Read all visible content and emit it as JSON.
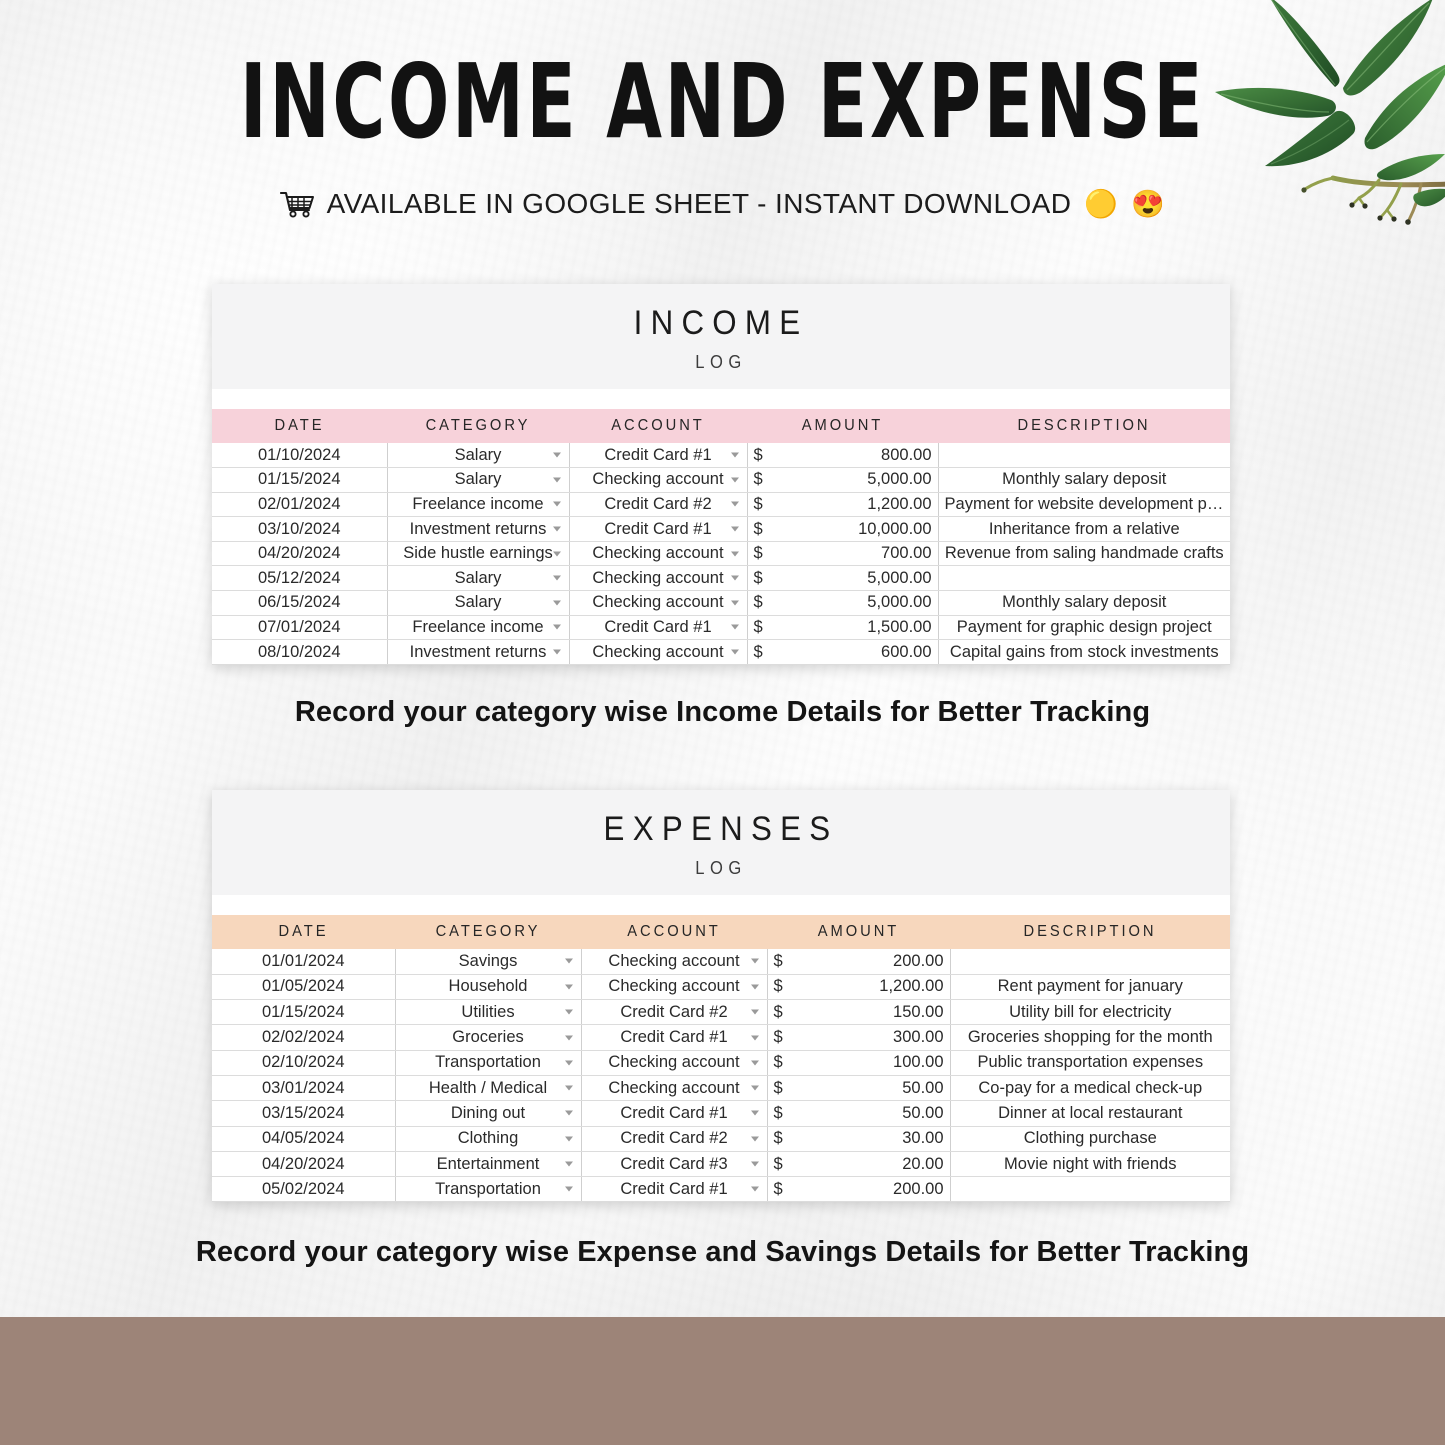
{
  "header": {
    "title": "INCOME AND EXPENSE",
    "subtitle": "AVAILABLE IN GOOGLE SHEET - INSTANT DOWNLOAD",
    "emoji_1": "🟡",
    "emoji_2": "😍",
    "cart_icon": "shopping-cart-icon"
  },
  "colors": {
    "income_header": "#f7d2da",
    "expense_header": "#f7d7bd",
    "banner": "#f4f4f5",
    "bottom_bar": "#9d8478",
    "page_background": "#f5f5f5"
  },
  "income": {
    "title": "INCOME",
    "subtitle": "LOG",
    "columns": [
      "DATE",
      "CATEGORY",
      "ACCOUNT",
      "AMOUNT",
      "DESCRIPTION"
    ],
    "rows": [
      {
        "date": "01/10/2024",
        "category": "Salary",
        "account": "Credit Card #1",
        "currency": "$",
        "amount": "800.00",
        "description": ""
      },
      {
        "date": "01/15/2024",
        "category": "Salary",
        "account": "Checking account",
        "currency": "$",
        "amount": "5,000.00",
        "description": "Monthly salary deposit"
      },
      {
        "date": "02/01/2024",
        "category": "Freelance income",
        "account": "Credit Card #2",
        "currency": "$",
        "amount": "1,200.00",
        "description": "Payment for website development project"
      },
      {
        "date": "03/10/2024",
        "category": "Investment returns",
        "account": "Credit Card #1",
        "currency": "$",
        "amount": "10,000.00",
        "description": "Inheritance from a relative"
      },
      {
        "date": "04/20/2024",
        "category": "Side hustle earnings",
        "account": "Checking account",
        "currency": "$",
        "amount": "700.00",
        "description": "Revenue from saling handmade crafts"
      },
      {
        "date": "05/12/2024",
        "category": "Salary",
        "account": "Checking account",
        "currency": "$",
        "amount": "5,000.00",
        "description": ""
      },
      {
        "date": "06/15/2024",
        "category": "Salary",
        "account": "Checking account",
        "currency": "$",
        "amount": "5,000.00",
        "description": "Monthly salary deposit"
      },
      {
        "date": "07/01/2024",
        "category": "Freelance income",
        "account": "Credit Card #1",
        "currency": "$",
        "amount": "1,500.00",
        "description": "Payment for graphic design project"
      },
      {
        "date": "08/10/2024",
        "category": "Investment returns",
        "account": "Checking account",
        "currency": "$",
        "amount": "600.00",
        "description": "Capital gains from stock investments"
      }
    ],
    "caption": "Record your category wise Income Details for Better Tracking"
  },
  "expenses": {
    "title": "EXPENSES",
    "subtitle": "LOG",
    "columns": [
      "DATE",
      "CATEGORY",
      "ACCOUNT",
      "AMOUNT",
      "DESCRIPTION"
    ],
    "rows": [
      {
        "date": "01/01/2024",
        "category": "Savings",
        "account": "Checking account",
        "currency": "$",
        "amount": "200.00",
        "description": ""
      },
      {
        "date": "01/05/2024",
        "category": "Household",
        "account": "Checking account",
        "currency": "$",
        "amount": "1,200.00",
        "description": "Rent payment for january"
      },
      {
        "date": "01/15/2024",
        "category": "Utilities",
        "account": "Credit Card #2",
        "currency": "$",
        "amount": "150.00",
        "description": "Utility bill for electricity"
      },
      {
        "date": "02/02/2024",
        "category": "Groceries",
        "account": "Credit Card #1",
        "currency": "$",
        "amount": "300.00",
        "description": "Groceries shopping for the month"
      },
      {
        "date": "02/10/2024",
        "category": "Transportation",
        "account": "Checking account",
        "currency": "$",
        "amount": "100.00",
        "description": "Public transportation expenses"
      },
      {
        "date": "03/01/2024",
        "category": "Health / Medical",
        "account": "Checking account",
        "currency": "$",
        "amount": "50.00",
        "description": "Co-pay for a medical check-up"
      },
      {
        "date": "03/15/2024",
        "category": "Dining out",
        "account": "Credit Card #1",
        "currency": "$",
        "amount": "50.00",
        "description": "Dinner at local restaurant"
      },
      {
        "date": "04/05/2024",
        "category": "Clothing",
        "account": "Credit Card #2",
        "currency": "$",
        "amount": "30.00",
        "description": "Clothing purchase"
      },
      {
        "date": "04/20/2024",
        "category": "Entertainment",
        "account": "Credit Card #3",
        "currency": "$",
        "amount": "20.00",
        "description": "Movie night with friends"
      },
      {
        "date": "05/02/2024",
        "category": "Transportation",
        "account": "Credit Card #1",
        "currency": "$",
        "amount": "200.00",
        "description": ""
      }
    ],
    "caption": "Record your category wise Expense and Savings Details for Better Tracking"
  },
  "decoration": {
    "leaves_icon": "leaf-branch-decoration"
  }
}
